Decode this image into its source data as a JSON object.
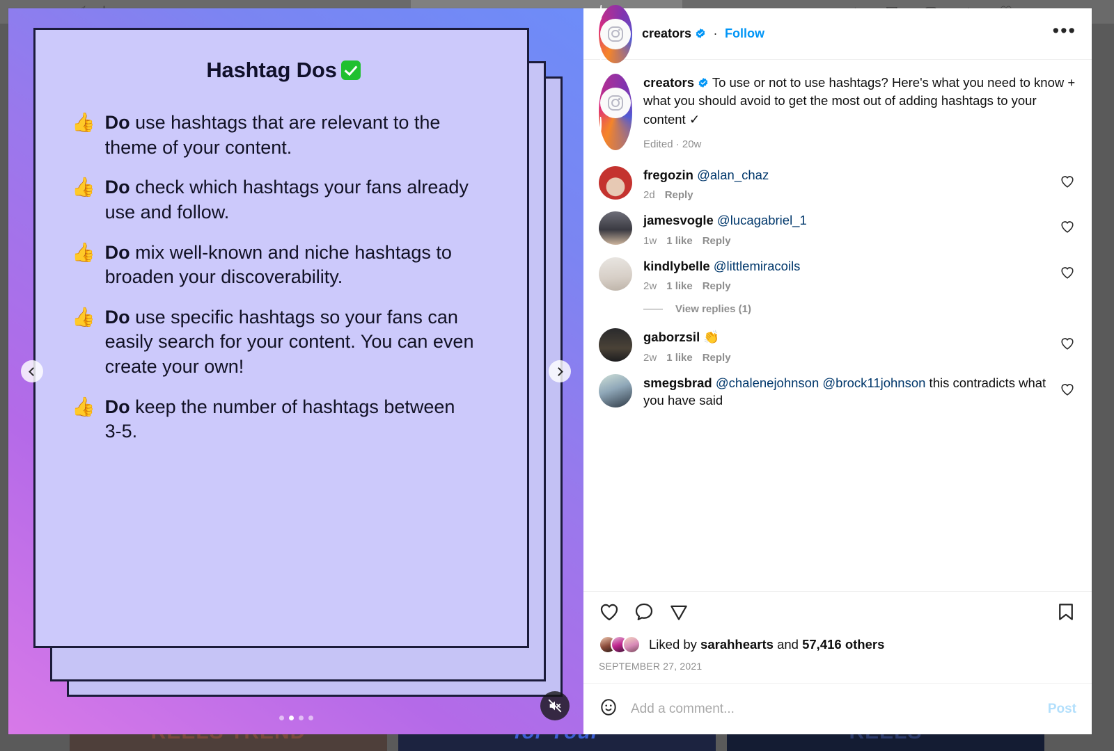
{
  "backdrop": {
    "cards": [
      {
        "label": "REELS TREND"
      },
      {
        "label": "for Your"
      },
      {
        "label": "REELS"
      }
    ]
  },
  "media": {
    "slide": {
      "title": "Hashtag Dos",
      "title_icon": "white-check-mark-emoji",
      "bullets": [
        {
          "icon": "thumbs-up-emoji",
          "lead": "Do",
          "text": " use hashtags that are relevant to the theme of your content."
        },
        {
          "icon": "thumbs-up-emoji",
          "lead": "Do",
          "text": " check which hashtags your fans already use and follow."
        },
        {
          "icon": "thumbs-up-emoji",
          "lead": "Do",
          "text": " mix well-known and niche hashtags to broaden your discoverability."
        },
        {
          "icon": "thumbs-up-emoji",
          "lead": "Do",
          "text": " use specific hashtags so your fans can easily search for your content. You can even create your own!"
        },
        {
          "icon": "thumbs-up-emoji",
          "lead": "Do",
          "text": " keep the number of hashtags between 3-5."
        }
      ]
    },
    "carousel": {
      "total_dots": 4,
      "active_index": 1
    },
    "prev_label": "Previous",
    "next_label": "Next",
    "mute_label": "Audio is muted",
    "gradient_from": "#d879e8",
    "gradient_to": "#6d8cf8",
    "card_bg": "#ccc9fb"
  },
  "header": {
    "username": "creators",
    "verified": true,
    "separator": "·",
    "follow_label": "Follow",
    "more_label": "•••"
  },
  "caption": {
    "username": "creators",
    "text": "To use or not to use hashtags? Here's what you need to know + what you should avoid to get the most out of adding hashtags to your content ✓",
    "meta": "Edited · 20w"
  },
  "comments": [
    {
      "avatar": "av-grad1",
      "username": "fregozin",
      "mention": "@alan_chaz",
      "rest": "",
      "time": "2d",
      "likes": "",
      "reply_label": "Reply",
      "view_replies": null
    },
    {
      "avatar": "av-grad2",
      "username": "jamesvogle",
      "mention": "@lucagabriel_1",
      "rest": "",
      "time": "1w",
      "likes": "1 like",
      "reply_label": "Reply",
      "view_replies": null
    },
    {
      "avatar": "av-grad3",
      "username": "kindlybelle",
      "mention": "@littlemiracoils",
      "rest": "",
      "time": "2w",
      "likes": "1 like",
      "reply_label": "Reply",
      "view_replies": "View replies (1)"
    },
    {
      "avatar": "av-grad4",
      "username": "gaborzsil",
      "mention": "",
      "rest": " 👏",
      "time": "2w",
      "likes": "1 like",
      "reply_label": "Reply",
      "view_replies": null
    },
    {
      "avatar": "av-grad5",
      "username": "smegsbrad",
      "mention": "@chalenejohnson @brock11johnson",
      "rest": " this contradicts what you have said",
      "time": "",
      "likes": "",
      "reply_label": "",
      "view_replies": null
    }
  ],
  "actions": {
    "like_label": "Like",
    "comment_label": "Comment",
    "share_label": "Share",
    "save_label": "Save"
  },
  "likes": {
    "prefix": "Liked by ",
    "user": "sarahhearts",
    "middle": " and ",
    "count": "57,416 others",
    "date": "SEPTEMBER 27, 2021"
  },
  "add_comment": {
    "emoji_label": "Emoji picker",
    "placeholder": "Add a comment...",
    "value": "",
    "post_label": "Post"
  }
}
